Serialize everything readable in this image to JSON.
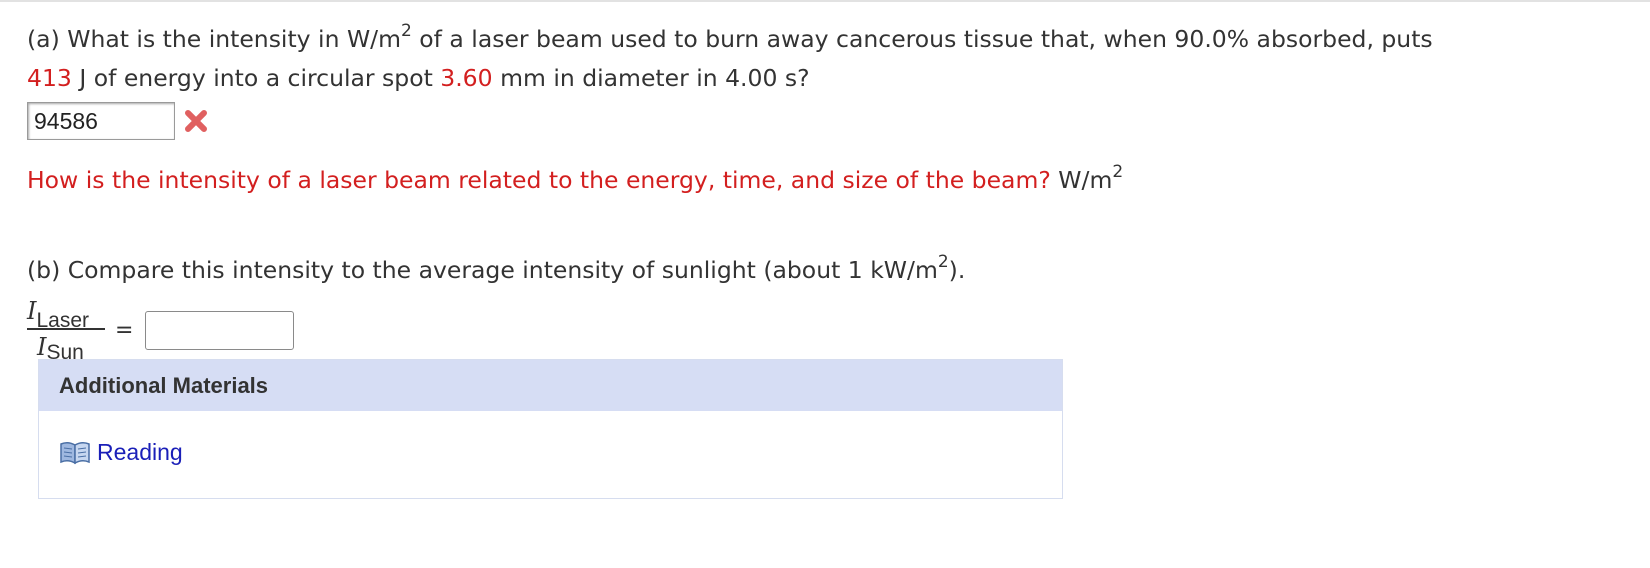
{
  "part_a": {
    "seg1": "(a) What is the intensity in W/m",
    "sup1": "2",
    "seg2": " of a laser beam used to burn away cancerous tissue that, when 90.0% absorbed, puts",
    "energy_value": "413",
    "seg3": " J of energy into a circular spot ",
    "diameter_value": "3.60",
    "seg4": " mm in diameter in 4.00 s?",
    "answer_value": "94586",
    "answer_status_icon": "incorrect-x-icon",
    "hint_text": "How is the intensity of a laser beam related to the energy, time, and size of the beam?",
    "unit_text": " W/m",
    "unit_sup": "2"
  },
  "part_b": {
    "seg1": "(b) Compare this intensity to the average intensity of sunlight (about 1 kW/m",
    "sup1": "2",
    "seg2": ").",
    "numerator_var": "I",
    "numerator_sub": "Laser",
    "denominator_var": "I",
    "denominator_sub": "Sun",
    "equals": "=",
    "answer_value": ""
  },
  "materials": {
    "header": "Additional Materials",
    "link_label": "Reading",
    "link_icon": "book-icon"
  },
  "colors": {
    "highlight_red": "#d31f1f",
    "incorrect_red": "#e06060",
    "panel_header_bg": "#d6ddf4",
    "link_blue": "#1a1fb8"
  }
}
